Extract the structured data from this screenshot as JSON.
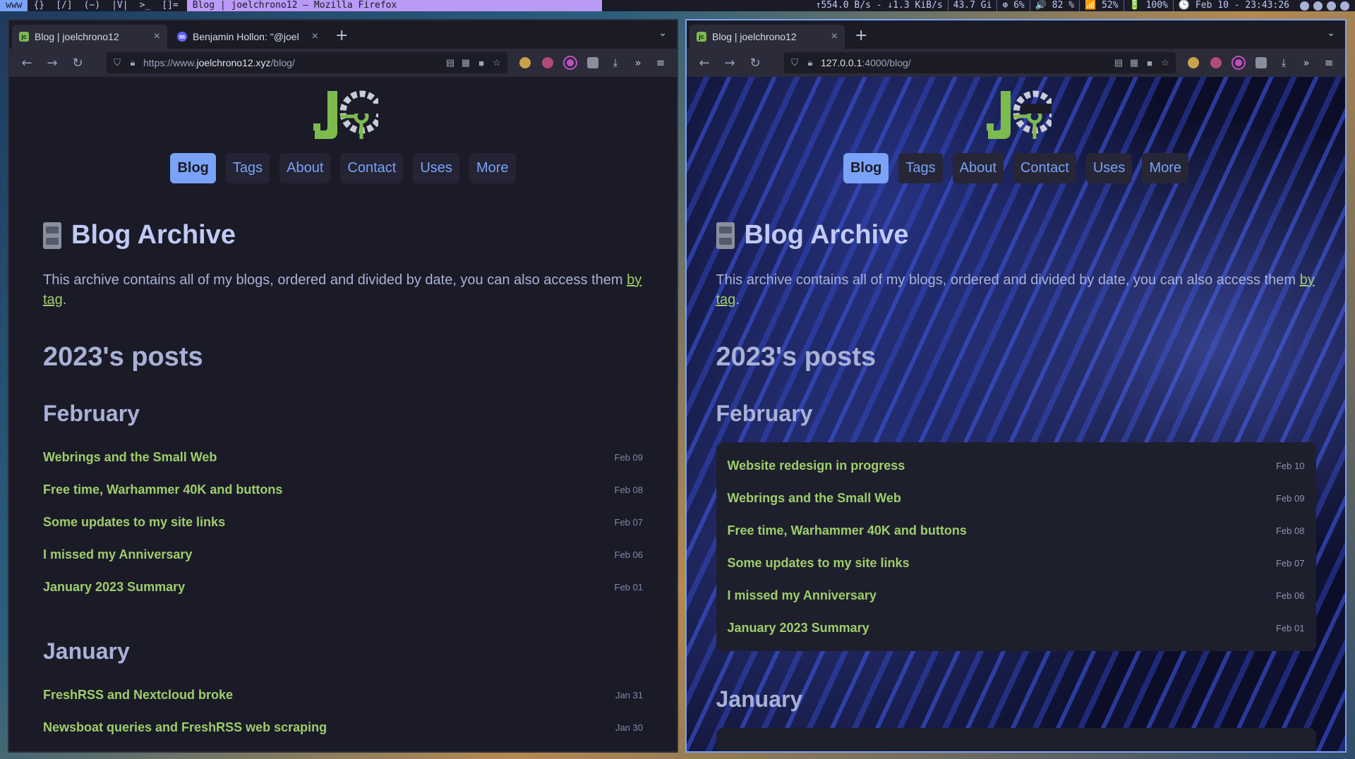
{
  "wm": {
    "workspaces": [
      "www",
      "{}",
      "[/]",
      "(~)",
      "|V|",
      ">_",
      "[]="
    ],
    "active_workspace": "www",
    "window_title": "Blog | joelchrono12 — Mozilla Firefox",
    "status": [
      "↑554.0 B/s - ↓1.3 KiB/s",
      "43.7 Gi",
      "⊛ 6%",
      "🔊 82 %",
      "📶 52%",
      "🔋 100%",
      "🕒 Feb 10 - 23:43:26"
    ]
  },
  "left": {
    "tabs": [
      {
        "title": "Blog | joelchrono12",
        "icon": "jc",
        "active": true
      },
      {
        "title": "Benjamin Hollon: \"@joel",
        "icon": "m",
        "active": false
      }
    ],
    "url_prefix": "https://www.",
    "url_host": "joelchrono12.xyz",
    "url_path": "/blog/",
    "nav": [
      "Blog",
      "Tags",
      "About",
      "Contact",
      "Uses",
      "More"
    ],
    "archive_title": "Blog Archive",
    "intro": "This archive contains all of my blogs, ordered and divided by date, you can also access them ",
    "intro_link": "by tag",
    "intro_end": ".",
    "year": "2023's posts",
    "month_feb": "February",
    "feb_posts": [
      {
        "title": "Webrings and the Small Web",
        "date": "Feb 09"
      },
      {
        "title": "Free time, Warhammer 40K and buttons",
        "date": "Feb 08"
      },
      {
        "title": "Some updates to my site links",
        "date": "Feb 07"
      },
      {
        "title": "I missed my Anniversary",
        "date": "Feb 06"
      },
      {
        "title": "January 2023 Summary",
        "date": "Feb 01"
      }
    ],
    "month_jan": "January",
    "jan_posts": [
      {
        "title": "FreshRSS and Nextcloud broke",
        "date": "Jan 31"
      },
      {
        "title": "Newsboat queries and FreshRSS web scraping",
        "date": "Jan 30"
      }
    ]
  },
  "right": {
    "tabs": [
      {
        "title": "Blog | joelchrono12",
        "icon": "jc",
        "active": true
      }
    ],
    "url_prefix": "",
    "url_host": "127.0.0.1",
    "url_path": ":4000/blog/",
    "nav": [
      "Blog",
      "Tags",
      "About",
      "Contact",
      "Uses",
      "More"
    ],
    "archive_title": "Blog Archive",
    "intro": "This archive contains all of my blogs, ordered and divided by date, you can also access them ",
    "intro_link": "by tag",
    "intro_end": ".",
    "year": "2023's posts",
    "month_feb": "February",
    "feb_posts": [
      {
        "title": "Website redesign in progress",
        "date": "Feb 10"
      },
      {
        "title": "Webrings and the Small Web",
        "date": "Feb 09"
      },
      {
        "title": "Free time, Warhammer 40K and buttons",
        "date": "Feb 08"
      },
      {
        "title": "Some updates to my site links",
        "date": "Feb 07"
      },
      {
        "title": "I missed my Anniversary",
        "date": "Feb 06"
      },
      {
        "title": "January 2023 Summary",
        "date": "Feb 01"
      }
    ],
    "month_jan": "January",
    "jan_posts": []
  },
  "colors": {
    "accent": "#7aa2f7",
    "link": "#9ece6a",
    "logo_green": "#7dbb4e"
  }
}
